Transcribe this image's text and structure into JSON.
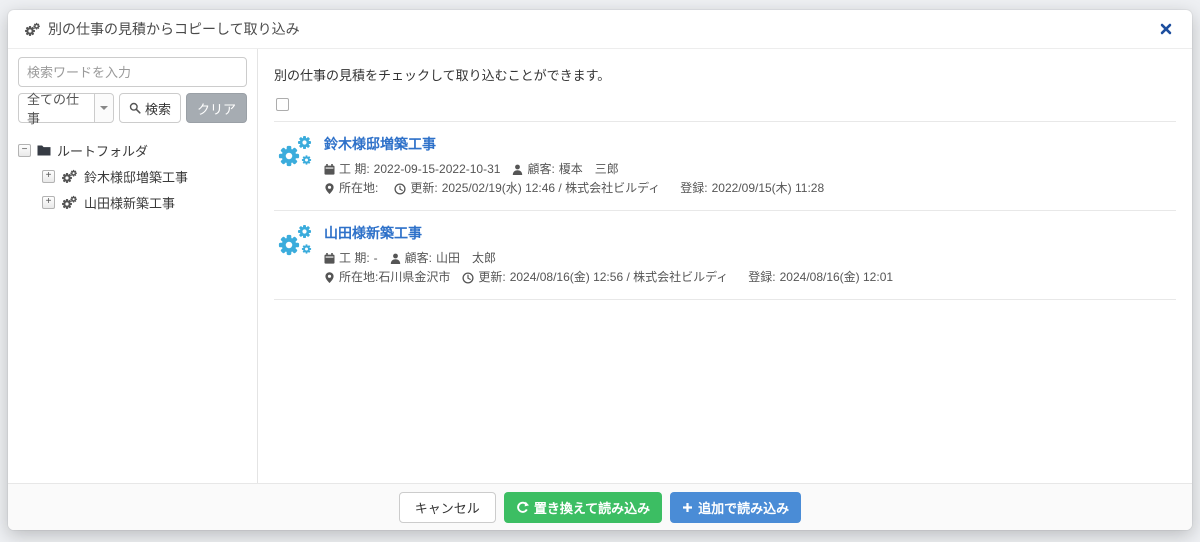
{
  "colors": {
    "accent_green": "#3cbe63",
    "accent_blue": "#4a8cd6",
    "link_blue": "#2e71c9",
    "cogs_cyan": "#3bacdc",
    "close_navy": "#1d4e9e",
    "clear_gray": "#a6acb2"
  },
  "header": {
    "title": "別の仕事の見積からコピーして取り込み"
  },
  "sidebar": {
    "search_placeholder": "検索ワードを入力",
    "filter_value": "全ての仕事",
    "search_label": "検索",
    "clear_label": "クリア",
    "tree": {
      "root_label": "ルートフォルダ",
      "root_toggle": "−",
      "child_toggle": "+",
      "items": [
        {
          "label": "鈴木様邸増築工事"
        },
        {
          "label": "山田様新築工事"
        }
      ]
    }
  },
  "main": {
    "instruction": "別の仕事の見積をチェックして取り込むことができます。",
    "labels": {
      "period": "工 期:",
      "customer": "顧客:",
      "location": "所在地:",
      "updated": "更新:",
      "registered": "登録:"
    },
    "items": [
      {
        "title": "鈴木様邸増築工事",
        "period": "2022-09-15-2022-10-31",
        "customer": "榎本　三郎",
        "location": "",
        "updated": "2025/02/19(水) 12:46 / 株式会社ビルディ",
        "registered": "2022/09/15(木) 11:28"
      },
      {
        "title": "山田様新築工事",
        "period": "-",
        "customer": "山田　太郎",
        "location": "石川県金沢市",
        "updated": "2024/08/16(金) 12:56 / 株式会社ビルディ",
        "registered": "2024/08/16(金) 12:01"
      }
    ]
  },
  "footer": {
    "cancel_label": "キャンセル",
    "replace_label": "置き換えて読み込み",
    "append_label": "追加で読み込み"
  }
}
